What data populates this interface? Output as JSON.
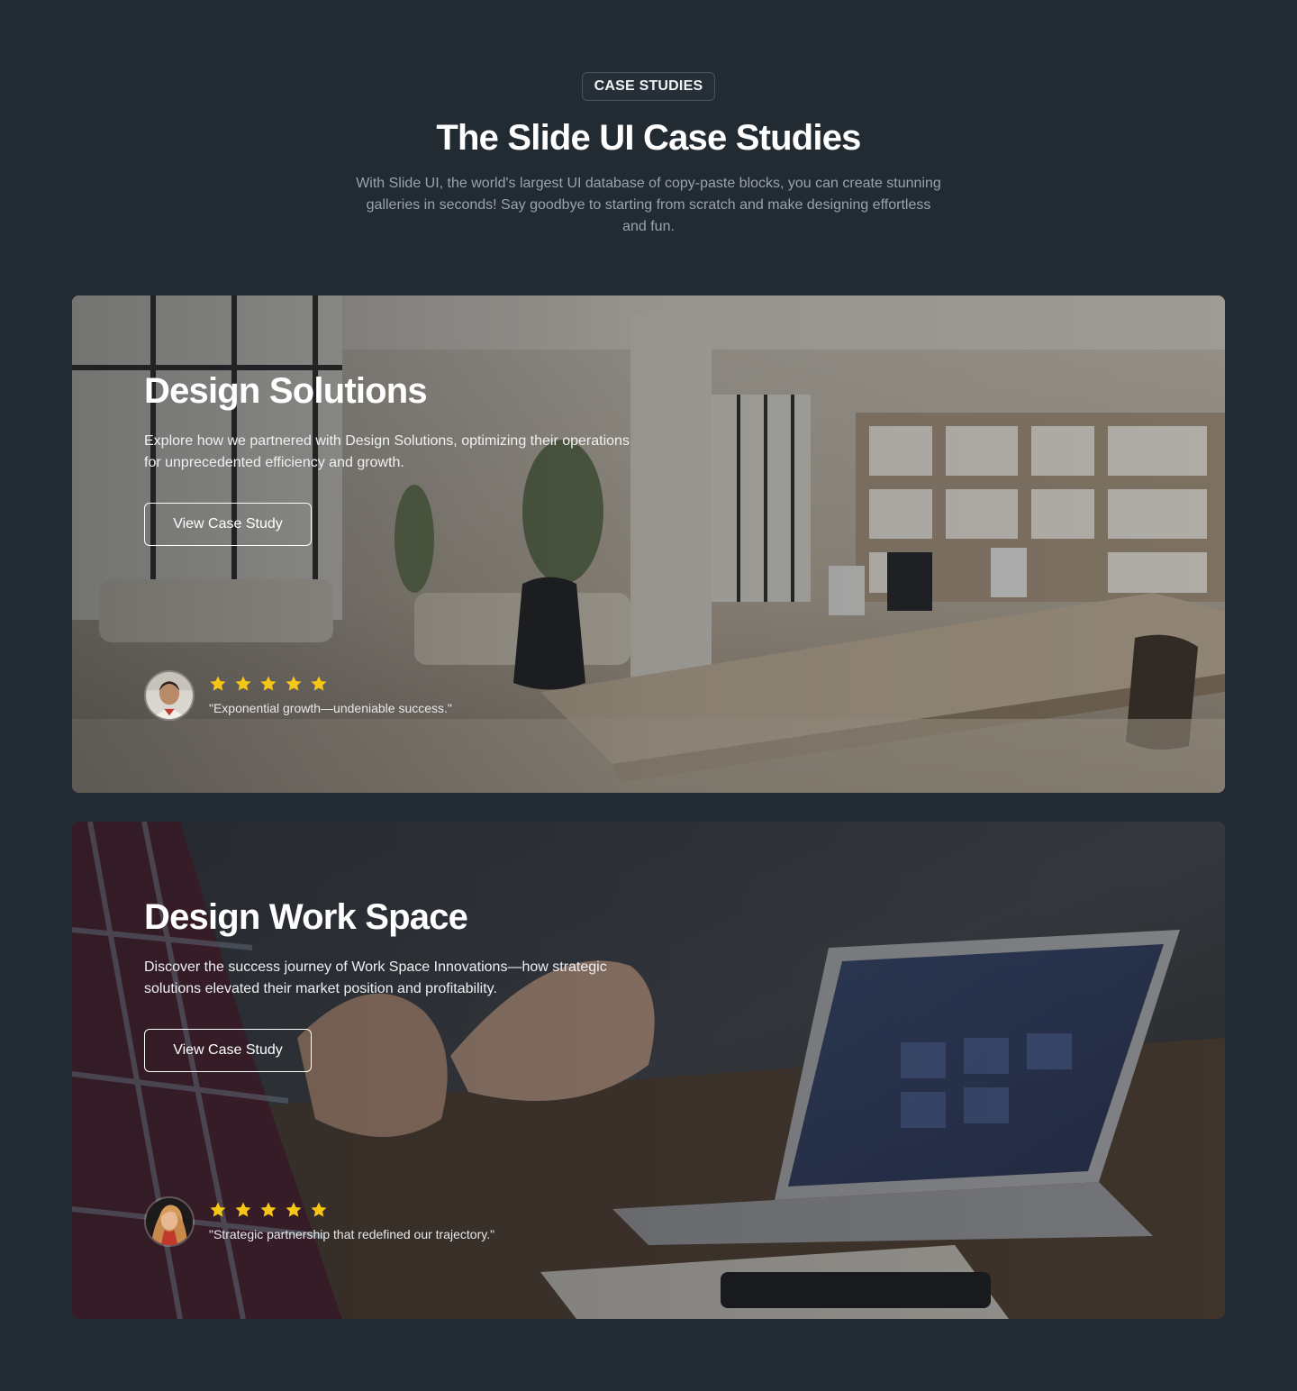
{
  "header": {
    "badge": "CASE STUDIES",
    "title": "The Slide UI Case Studies",
    "subtitle": "With Slide UI, the world's largest UI database of copy-paste blocks, you can create stunning galleries in seconds! Say goodbye to starting from scratch and make designing effortless and fun."
  },
  "cards": [
    {
      "title": "Design Solutions",
      "description": "Explore how we partnered with Design Solutions, optimizing their operations for unprecedented efficiency and growth.",
      "cta": "View Case Study",
      "rating": 5,
      "quote": "\"Exponential growth—undeniable success.\""
    },
    {
      "title": "Design Work Space",
      "description": "Discover the success journey of Work Space Innovations—how strategic solutions elevated their market position and profitability.",
      "cta": "View Case Study",
      "rating": 5,
      "quote": "\"Strategic partnership that redefined our trajectory.\""
    }
  ],
  "colors": {
    "background": "#222a32",
    "star": "#f5c518",
    "text_muted": "#9aa3ad"
  }
}
